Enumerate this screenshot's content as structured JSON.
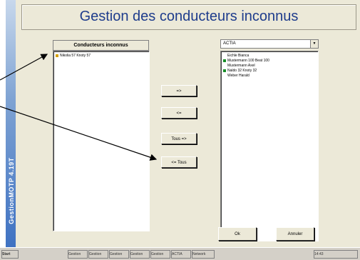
{
  "window": {
    "title": "Gestion des conducteurs inconnus",
    "sidebar_label": "GestionMOTP 4.19T"
  },
  "left_panel": {
    "header": "Conducteurs inconnus",
    "items": [
      {
        "label": "Nikolia 57 Knoty 57",
        "icon": "pin-icon"
      }
    ]
  },
  "right_panel": {
    "dropdown_value": "ACTIA",
    "items": [
      {
        "label": "Eichle Bianca",
        "icon": "none"
      },
      {
        "label": "Mustermann 100 Beat 100",
        "icon": "green-driver-icon"
      },
      {
        "label": "Mustermann Axel",
        "icon": "none"
      },
      {
        "label": "Naldo 32 Knoty 32",
        "icon": "green-driver-icon"
      },
      {
        "label": "Weber Harald",
        "icon": "none"
      }
    ]
  },
  "buttons": {
    "move_right": "=>",
    "move_left": "<=",
    "move_all_right": "Tous =>",
    "move_all_left": "<= Tous",
    "ok": "Ok",
    "cancel": "Annuler"
  },
  "taskbar": {
    "start": "Start",
    "items": [
      "Gestion",
      "Gestion",
      "Gestion",
      "Gestion",
      "Gestion",
      "ACTIA",
      "Network"
    ],
    "tray": "14:43"
  },
  "colors": {
    "title": "#1e3c8c",
    "accent_green": "#1a8f2a"
  }
}
